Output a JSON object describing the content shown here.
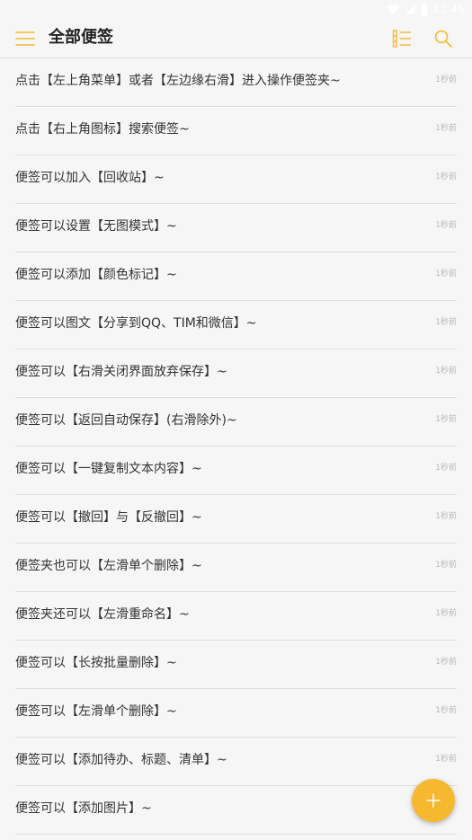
{
  "status_bar": {
    "time": "11:46"
  },
  "header": {
    "title": "全部便签"
  },
  "notes": [
    {
      "text": "点击【左上角菜单】或者【左边缘右滑】进入操作便签夹~",
      "time": "1秒前"
    },
    {
      "text": "点击【右上角图标】搜索便签~",
      "time": "1秒前"
    },
    {
      "text": "便签可以加入【回收站】~",
      "time": "1秒前"
    },
    {
      "text": "便签可以设置【无图模式】~",
      "time": "1秒前"
    },
    {
      "text": "便签可以添加【颜色标记】~",
      "time": "1秒前"
    },
    {
      "text": "便签可以图文【分享到QQ、TIM和微信】~",
      "time": "1秒前"
    },
    {
      "text": "便签可以【右滑关闭界面放弃保存】~",
      "time": "1秒前"
    },
    {
      "text": "便签可以【返回自动保存】(右滑除外)~",
      "time": "1秒前"
    },
    {
      "text": "便签可以【一键复制文本内容】~",
      "time": "1秒前"
    },
    {
      "text": "便签可以【撤回】与【反撤回】~",
      "time": "1秒前"
    },
    {
      "text": "便签夹也可以【左滑单个删除】~",
      "time": "1秒前"
    },
    {
      "text": "便签夹还可以【左滑重命名】~",
      "time": "1秒前"
    },
    {
      "text": "便签可以【长按批量删除】~",
      "time": "1秒前"
    },
    {
      "text": "便签可以【左滑单个删除】~",
      "time": "1秒前"
    },
    {
      "text": "便签可以【添加待办、标题、清单】~",
      "time": "1秒前"
    },
    {
      "text": "便签可以【添加图片】~",
      "time": ""
    }
  ],
  "colors": {
    "accent": "#f6b82f",
    "background": "#f6f6f6",
    "divider": "#dddddd",
    "text_primary": "#333333",
    "text_secondary": "#b8b8b8"
  },
  "icons": {
    "menu": "hamburger-menu-icon",
    "list_view": "list-view-icon",
    "search": "search-icon",
    "add": "plus-icon",
    "wifi": "wifi-icon",
    "signal": "signal-icon",
    "battery": "battery-icon"
  }
}
